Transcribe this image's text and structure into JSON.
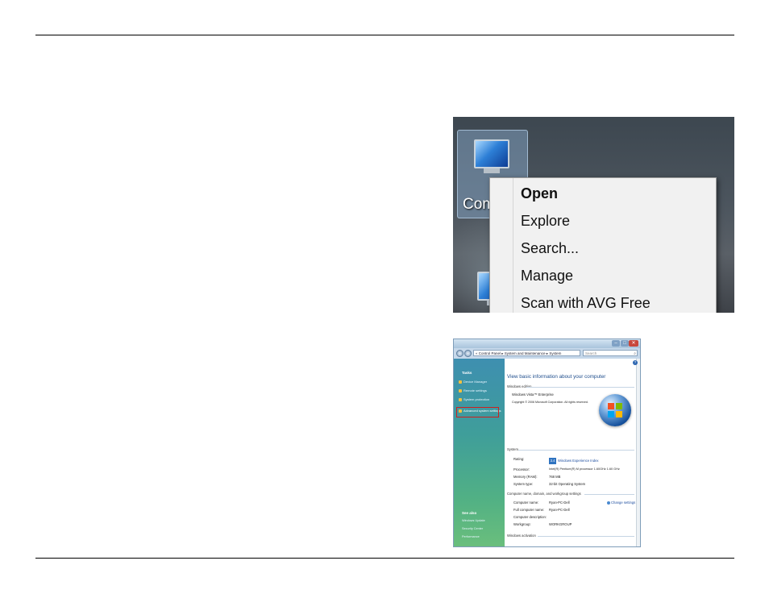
{
  "menu": {
    "desktop_icon_label": "Com",
    "items": [
      "Open",
      "Explore",
      "Search...",
      "Manage",
      "Scan with AVG Free"
    ]
  },
  "window": {
    "address": "« Control Panel ▸ System and Maintenance ▸ System",
    "search_placeholder": "Search",
    "tasks_heading": "Tasks",
    "tasks": [
      "Device Manager",
      "Remote settings",
      "System protection",
      "Advanced system settings"
    ],
    "see_also_heading": "See also",
    "see_also": [
      "Windows Update",
      "Security Center",
      "Performance"
    ],
    "heading": "View basic information about your computer",
    "sections": {
      "edition": "Windows edition",
      "system": "System",
      "computer": "Computer name, domain, and workgroup settings",
      "activation": "Windows activation"
    },
    "edition_name": "Windows Vista™ Enterprise",
    "copyright": "Copyright © 2006 Microsoft Corporation.  All rights reserved.",
    "system_rows": [
      {
        "label": "Rating:",
        "value": "Windows Experience Index"
      },
      {
        "label": "Processor:",
        "value": "Intel(R) Pentium(R) M processor 1.60GHz   1.60 GHz"
      },
      {
        "label": "Memory (RAM):",
        "value": "768 MB"
      },
      {
        "label": "System type:",
        "value": "32-bit Operating System"
      }
    ],
    "rating_badge": "3.4",
    "computer_rows": [
      {
        "label": "Computer name:",
        "value": "Ryan-PC-Dell"
      },
      {
        "label": "Full computer name:",
        "value": "Ryan-PC-Dell"
      },
      {
        "label": "Computer description:",
        "value": ""
      },
      {
        "label": "Workgroup:",
        "value": "WORKGROUP"
      }
    ],
    "change_settings": "Change settings"
  }
}
